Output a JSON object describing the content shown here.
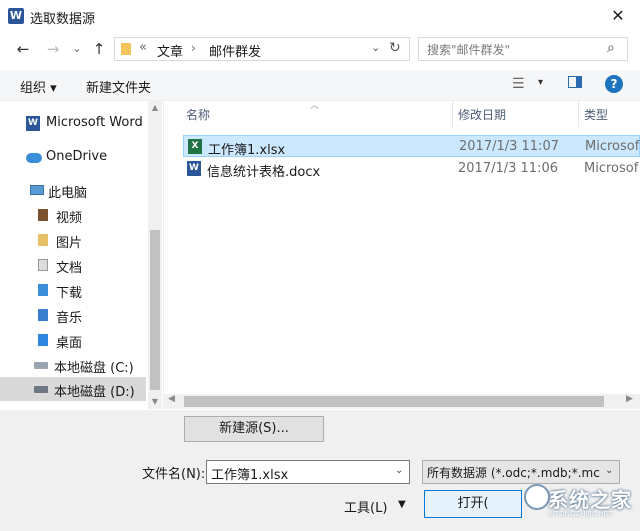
{
  "window": {
    "title": "选取数据源",
    "close_label": "✕"
  },
  "nav": {
    "back": "←",
    "forward": "→",
    "recent": "⌄",
    "up": "↑",
    "address": {
      "overflow": "«",
      "segments": [
        "文章",
        "邮件群发"
      ],
      "separator": "›",
      "dropdown": "⌄",
      "refresh": "↻"
    },
    "search": {
      "placeholder": "搜索\"邮件群发\"",
      "icon": "search-icon"
    }
  },
  "toolbar": {
    "organize": "组织 ▾",
    "new_folder": "新建文件夹",
    "view_dropdown": "▾",
    "help": "?"
  },
  "sidebar": {
    "items": [
      {
        "label": "Microsoft Word",
        "icon": "word-icon"
      },
      {
        "label": "OneDrive",
        "icon": "onedrive-icon"
      },
      {
        "label": "此电脑",
        "icon": "computer-icon"
      },
      {
        "label": "视频",
        "icon": "video-folder-icon"
      },
      {
        "label": "图片",
        "icon": "pictures-folder-icon"
      },
      {
        "label": "文档",
        "icon": "documents-folder-icon"
      },
      {
        "label": "下载",
        "icon": "downloads-folder-icon"
      },
      {
        "label": "音乐",
        "icon": "music-folder-icon"
      },
      {
        "label": "桌面",
        "icon": "desktop-folder-icon"
      },
      {
        "label": "本地磁盘 (C:)",
        "icon": "drive-icon"
      },
      {
        "label": "本地磁盘 (D:)",
        "icon": "drive-icon",
        "selected": true
      }
    ]
  },
  "filelist": {
    "columns": [
      "名称",
      "修改日期",
      "类型"
    ],
    "rows": [
      {
        "name": "工作簿1.xlsx",
        "date": "2017/1/3 11:07",
        "type": "Microsof",
        "icon": "excel-icon",
        "selected": true
      },
      {
        "name": "信息统计表格.docx",
        "date": "2017/1/3 11:06",
        "type": "Microsof",
        "icon": "word-doc-icon"
      }
    ]
  },
  "bottom": {
    "new_source": "新建源(S)...",
    "filename_label": "文件名(N):",
    "filename_value": "工作簿1.xlsx",
    "filetype_value": "所有数据源 (*.odc;*.mdb;*.mc",
    "tools": "工具(L)",
    "open": "打开("
  },
  "watermark": {
    "text": "系统之家",
    "sub": "XITONGZHIJIA.NET"
  },
  "colors": {
    "selected_row": "#cce8ff",
    "selected_nav": "#d9d9d9",
    "accent": "#0078d7"
  }
}
